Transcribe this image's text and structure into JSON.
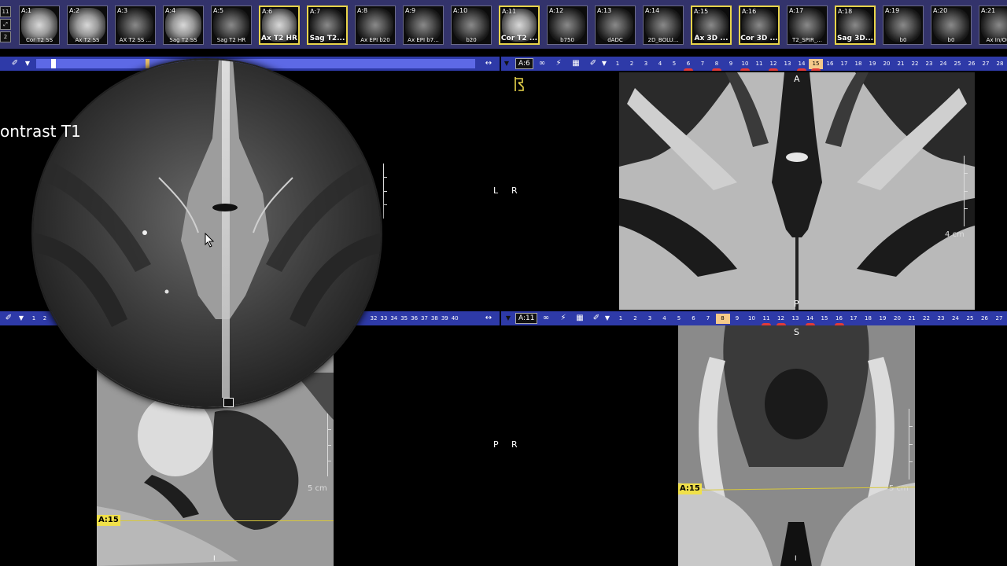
{
  "thumbnails": [
    {
      "num": "A:1",
      "label": "Cor T2 SS",
      "selected": false,
      "bright": true
    },
    {
      "num": "A:2",
      "label": "Ax T2 SS",
      "selected": false,
      "bright": true
    },
    {
      "num": "A:3",
      "label": "AX T2 SS ...",
      "selected": false,
      "bright": false
    },
    {
      "num": "A:4",
      "label": "Sag T2 SS",
      "selected": false,
      "bright": true
    },
    {
      "num": "A:5",
      "label": "Sag T2 HR",
      "selected": false,
      "bright": false
    },
    {
      "num": "A:6",
      "label": "Ax T2 HR",
      "selected": true,
      "bright": true
    },
    {
      "num": "A:7",
      "label": "Sag T2...",
      "selected": true,
      "bright": false
    },
    {
      "num": "A:8",
      "label": "Ax EPI b20",
      "selected": false,
      "bright": false
    },
    {
      "num": "A:9",
      "label": "Ax EPI b7...",
      "selected": false,
      "bright": false
    },
    {
      "num": "A:10",
      "label": "b20",
      "selected": false,
      "bright": false
    },
    {
      "num": "A:11",
      "label": "Cor T2 ...",
      "selected": true,
      "bright": true
    },
    {
      "num": "A:12",
      "label": "b750",
      "selected": false,
      "bright": false
    },
    {
      "num": "A:13",
      "label": "dADC",
      "selected": false,
      "bright": false
    },
    {
      "num": "A:14",
      "label": "2D_BOLU...",
      "selected": false,
      "bright": false
    },
    {
      "num": "A:15",
      "label": "Ax 3D ...",
      "selected": true,
      "bright": false
    },
    {
      "num": "A:16",
      "label": "Cor 3D ...",
      "selected": true,
      "bright": false
    },
    {
      "num": "A:17",
      "label": "T2_SPIR_...",
      "selected": false,
      "bright": false
    },
    {
      "num": "A:18",
      "label": "Sag 3D...",
      "selected": true,
      "bright": false
    },
    {
      "num": "A:19",
      "label": "b0",
      "selected": false,
      "bright": false
    },
    {
      "num": "A:20",
      "label": "b0",
      "selected": false,
      "bright": false
    },
    {
      "num": "A:21",
      "label": "Ax In/Out",
      "selected": false,
      "bright": false
    }
  ],
  "side_mini": {
    "top": "11",
    "bottom": "2"
  },
  "toolbar_top_left": {
    "series": "",
    "slices": []
  },
  "toolbar_top_right": {
    "series": "A:6",
    "slices": [
      "1",
      "2",
      "3",
      "4",
      "5",
      "6",
      "7",
      "8",
      "9",
      "10",
      "11",
      "12",
      "13",
      "14",
      "15",
      "16",
      "17",
      "18",
      "19",
      "20",
      "21",
      "22",
      "23",
      "24",
      "25",
      "26",
      "27",
      "28"
    ],
    "current": "15",
    "marked": [
      "6",
      "8",
      "10",
      "12",
      "14",
      "15"
    ]
  },
  "toolbar_bottom_left": {
    "series": "",
    "slices_left": [
      "1",
      "2"
    ],
    "slices_right": [
      "32",
      "33",
      "34",
      "35",
      "36",
      "37",
      "38",
      "39",
      "40"
    ]
  },
  "toolbar_bottom_right": {
    "series": "A:11",
    "slices": [
      "1",
      "2",
      "3",
      "4",
      "5",
      "6",
      "7",
      "8",
      "9",
      "10",
      "11",
      "12",
      "13",
      "14",
      "15",
      "16",
      "17",
      "18",
      "19",
      "20",
      "21",
      "22",
      "23",
      "24",
      "25",
      "26",
      "27"
    ],
    "current": "8",
    "marked": [
      "11",
      "12",
      "14",
      "16"
    ]
  },
  "panes": {
    "top_left": {
      "orient_left": "L",
      "orient_right": "R",
      "caption": "ontrast T1"
    },
    "top_right": {
      "orient_top": "A",
      "orient_bottom": "P",
      "scale": "4 cm"
    },
    "bottom_left": {
      "scale": "5 cm",
      "ref": "A:15",
      "orient_bottom": "I"
    },
    "bottom_mid": {
      "orient_left": "P",
      "orient_right": "R"
    },
    "bottom_right": {
      "orient_top": "S",
      "scale": "5 cm",
      "ref": "A:15",
      "orient_bottom": "I"
    }
  }
}
